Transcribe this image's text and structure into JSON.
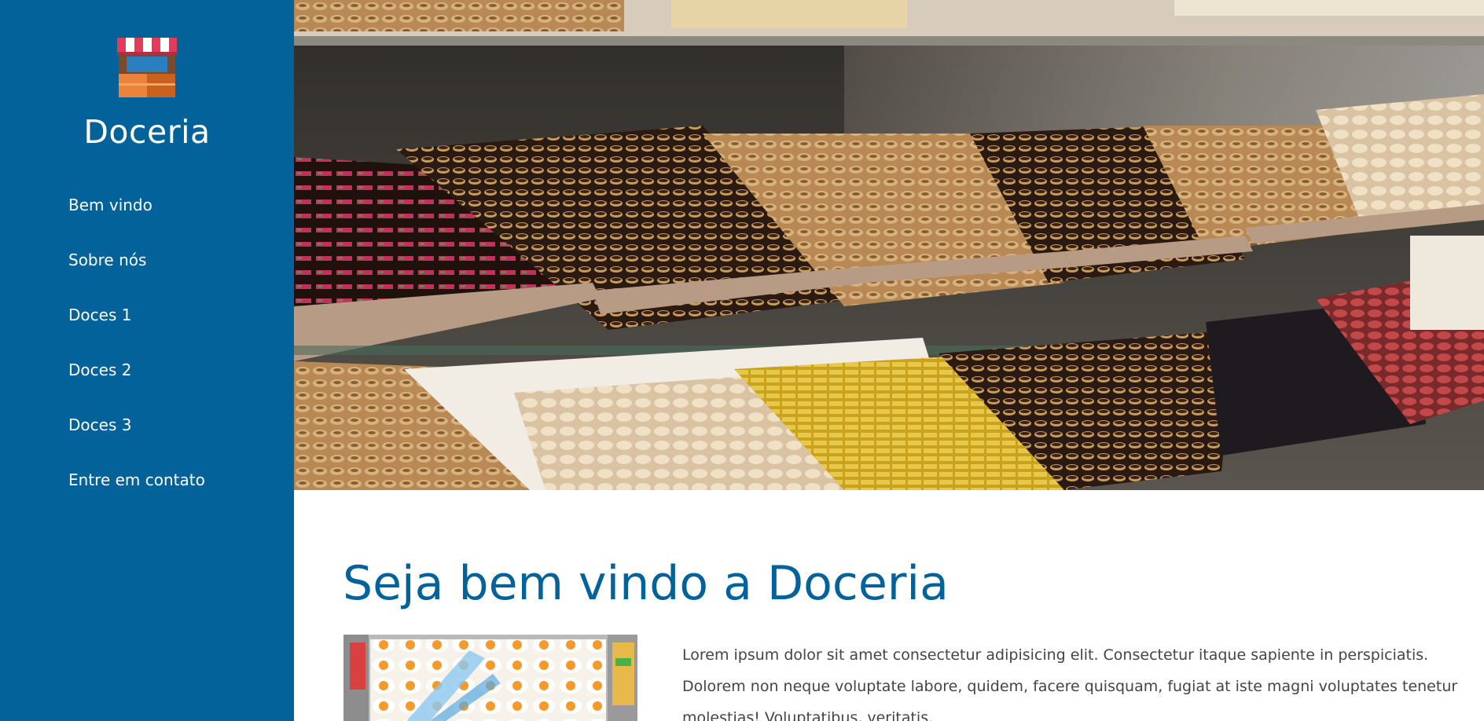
{
  "brand": {
    "name": "Doceria",
    "logo_icon": "shop-icon"
  },
  "nav": {
    "items": [
      {
        "label": "Bem vindo"
      },
      {
        "label": "Sobre nós"
      },
      {
        "label": "Doces 1"
      },
      {
        "label": "Doces 2"
      },
      {
        "label": "Doces 3"
      },
      {
        "label": "Entre em contato"
      }
    ]
  },
  "main": {
    "title": "Seja bem vindo a Doceria",
    "paragraph": "Lorem ipsum dolor sit amet consectetur adipisicing elit. Consectetur itaque sapiente in perspiciatis. Dolorem non neque voluptate labore, quidem, facere quisquam, fugiat at iste magni voluptates tenetur molestias! Voluptatibus, veritatis."
  },
  "colors": {
    "sidebar": "#03629a",
    "title": "#03629a",
    "text": "#444444"
  }
}
